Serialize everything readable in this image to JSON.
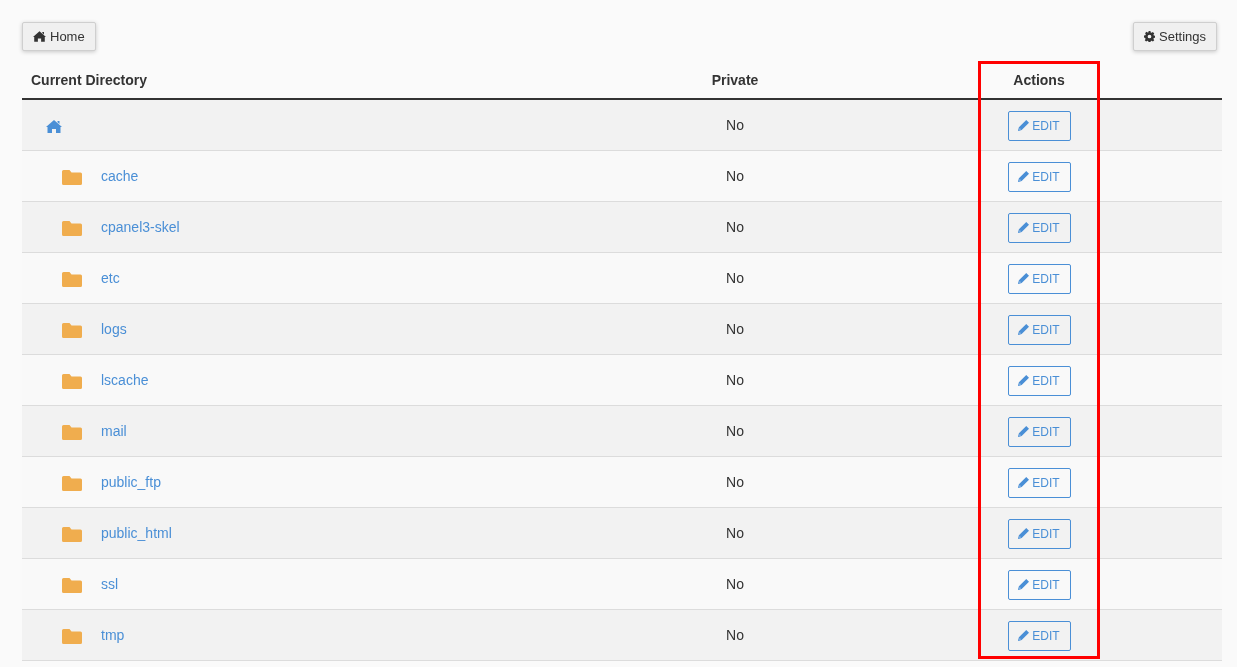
{
  "toolbar": {
    "home_button": {
      "label": "Home"
    },
    "settings_button": {
      "label": "Settings"
    }
  },
  "table": {
    "columns": [
      {
        "label": "Current Directory",
        "highlighted": false
      },
      {
        "label": "Private",
        "highlighted": false
      },
      {
        "label": "Actions",
        "highlighted": true
      }
    ],
    "rows": [
      {
        "kind": "home",
        "private": "No",
        "action": "EDIT"
      },
      {
        "kind": "folder",
        "name": "cache",
        "private": "No",
        "action": "EDIT"
      },
      {
        "kind": "folder",
        "name": "cpanel3-skel",
        "private": "No",
        "action": "EDIT"
      },
      {
        "kind": "folder",
        "name": "etc",
        "private": "No",
        "action": "EDIT"
      },
      {
        "kind": "folder",
        "name": "logs",
        "private": "No",
        "action": "EDIT"
      },
      {
        "kind": "folder",
        "name": "lscache",
        "private": "No",
        "action": "EDIT"
      },
      {
        "kind": "folder",
        "name": "mail",
        "private": "No",
        "action": "EDIT"
      },
      {
        "kind": "folder",
        "name": "public_ftp",
        "private": "No",
        "action": "EDIT"
      },
      {
        "kind": "folder",
        "name": "public_html",
        "private": "No",
        "action": "EDIT"
      },
      {
        "kind": "folder",
        "name": "ssl",
        "private": "No",
        "action": "EDIT"
      },
      {
        "kind": "folder",
        "name": "tmp",
        "private": "No",
        "action": "EDIT"
      }
    ]
  }
}
